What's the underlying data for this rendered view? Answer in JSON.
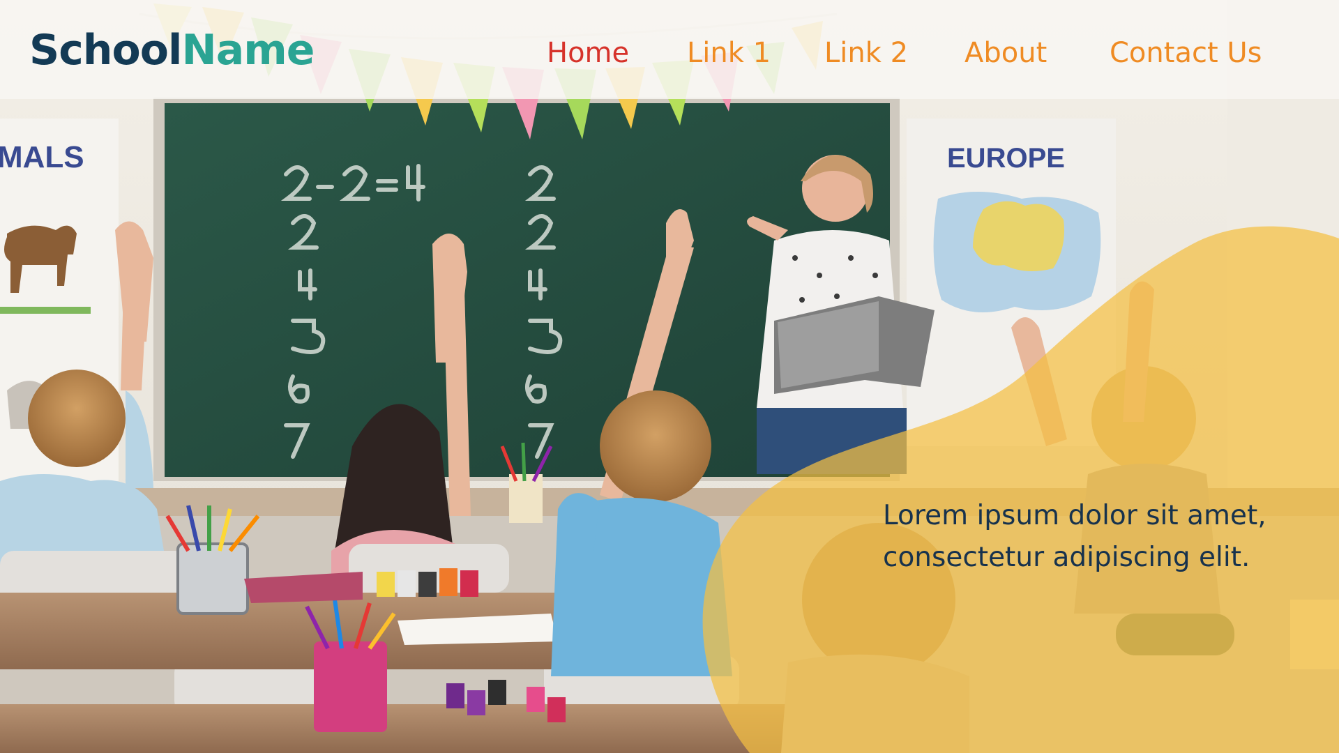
{
  "header": {
    "logo_part1": "School",
    "logo_part2": "Name"
  },
  "nav": {
    "home": "Home",
    "link1": "Link 1",
    "link2": "Link 2",
    "about": "About",
    "contact": "Contact Us"
  },
  "hero": {
    "text_line1": "Lorem ipsum dolor sit amet,",
    "text_line2": "consectetur adipiscing elit."
  },
  "colors": {
    "logo_dark": "#133a55",
    "logo_teal": "#2aa493",
    "nav_active": "#d6322a",
    "nav_default": "#ef8b23",
    "hero_overlay": "#f4bf43",
    "hero_text": "#17324d"
  }
}
